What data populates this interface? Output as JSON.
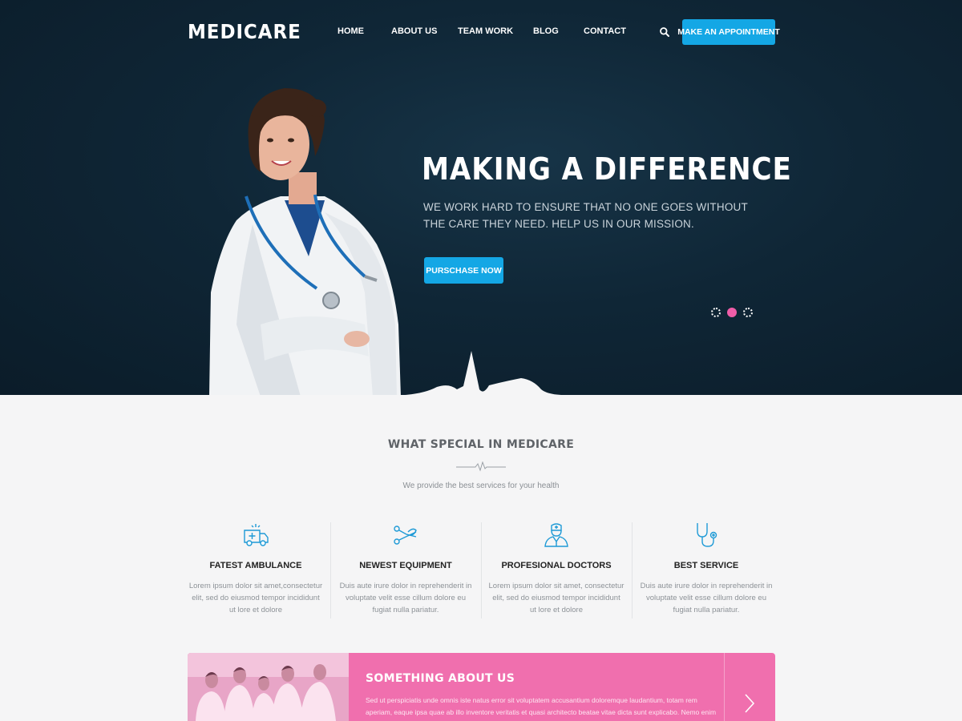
{
  "header": {
    "logo": "MEDICARE",
    "nav": [
      "HOME",
      "ABOUT US",
      "TEAM WORK",
      "BLOG",
      "CONTACT"
    ],
    "appointment_label": "MAKE AN APPOINTMENT",
    "search_icon": "search-icon"
  },
  "hero": {
    "title": "MAKING A DIFFERENCE",
    "subtitle": "WE WORK HARD TO ENSURE THAT NO ONE GOES WITHOUT THE CARE THEY NEED. HELP US IN OUR MISSION.",
    "button_label": "PURSCHASE NOW",
    "slides": 3,
    "active_slide": 2
  },
  "features_section": {
    "title": "WHAT SPECIAL IN MEDICARE",
    "subtitle": "We provide the best services for your health",
    "items": [
      {
        "icon": "ambulance-icon",
        "title": "FATEST AMBULANCE",
        "text": "Lorem ipsum dolor sit amet,consectetur elit, sed do eiusmod tempor incididunt ut lore et dolore"
      },
      {
        "icon": "equipment-icon",
        "title": "NEWEST EQUIPMENT",
        "text": "Duis aute irure dolor in reprehenderit in voluptate velit esse cillum dolore eu fugiat nulla pariatur."
      },
      {
        "icon": "doctor-icon",
        "title": "PROFESIONAL DOCTORS",
        "text": "Lorem ipsum dolor sit amet, consectetur elit, sed do eiusmod tempor incididunt ut lore et dolore"
      },
      {
        "icon": "stethoscope-icon",
        "title": "BEST SERVICE",
        "text": "Duis aute irure dolor in reprehenderit in voluptate velit esse cillum dolore eu fugiat nulla pariatur."
      }
    ]
  },
  "about": {
    "title": "SOMETHING ABOUT US",
    "text": "Sed ut perspiciatis unde omnis iste natus error sit voluptatem accusantium doloremque laudantium, totam rem aperiam, eaque ipsa quae ab illo inventore veritatis et quasi architecto beatae vitae dicta sunt explicabo. Nemo enim"
  },
  "colors": {
    "accent_blue": "#14a7e5",
    "accent_pink": "#f06fae",
    "hero_dark": "#0f2636",
    "background": "#f5f5f6"
  }
}
